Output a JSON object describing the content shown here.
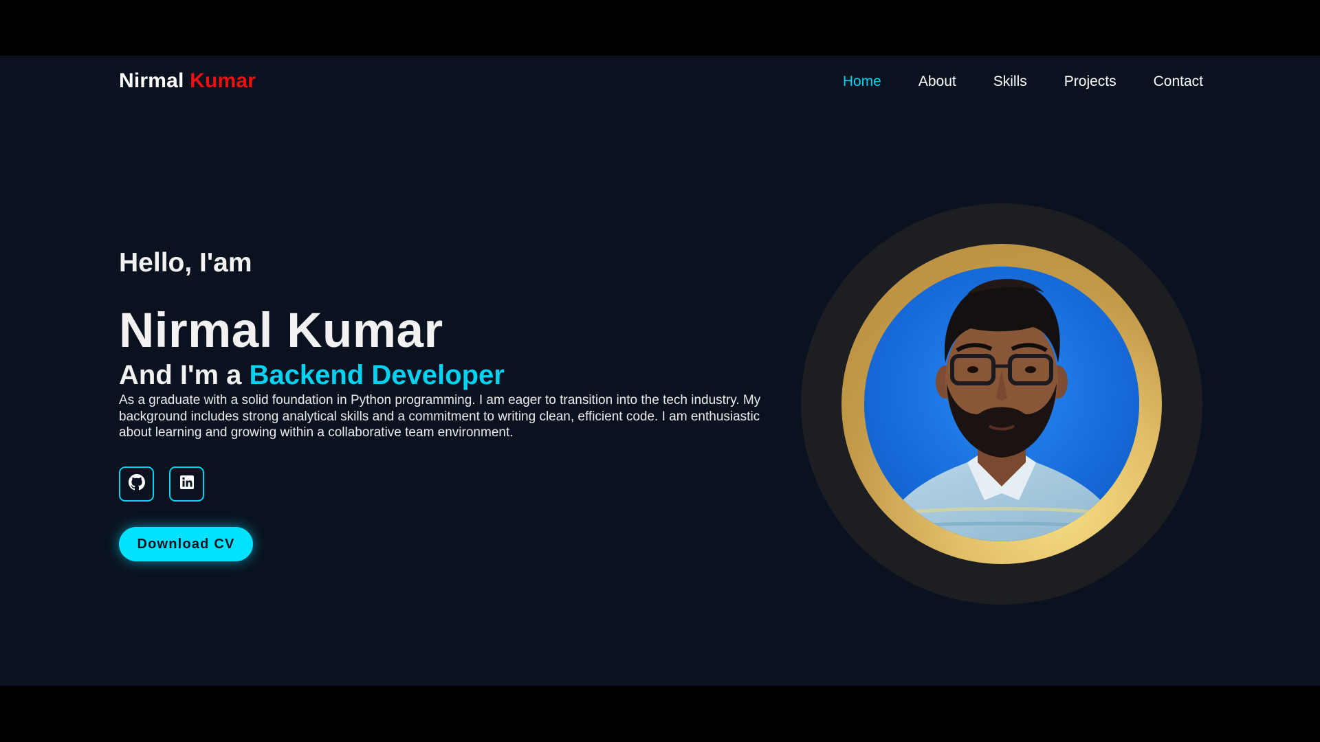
{
  "header": {
    "logo_first": "Nirmal",
    "logo_second": "Kumar",
    "nav": [
      {
        "label": "Home",
        "active": true
      },
      {
        "label": "About"
      },
      {
        "label": "Skills"
      },
      {
        "label": "Projects"
      },
      {
        "label": "Contact"
      }
    ]
  },
  "hero": {
    "greeting": "Hello, I'am",
    "name": "Nirmal Kumar",
    "role_prefix": "And I'm a",
    "role": "Backend Developer",
    "description": "As a graduate with a solid foundation in Python programming. I am eager to transition into the tech industry. My background includes strong analytical skills and a commitment to writing clean, efficient code. I am enthusiastic about learning and growing within a collaborative team environment.",
    "socials": [
      {
        "icon": "github-icon"
      },
      {
        "icon": "linkedin-icon"
      }
    ],
    "cta_label": "Download CV"
  },
  "colors": {
    "background": "#0a1220",
    "accent": "#00d2f2",
    "logo_accent": "#ee1111",
    "ring_outer": "#1c1e22",
    "ring_gold": "#c39a48"
  }
}
